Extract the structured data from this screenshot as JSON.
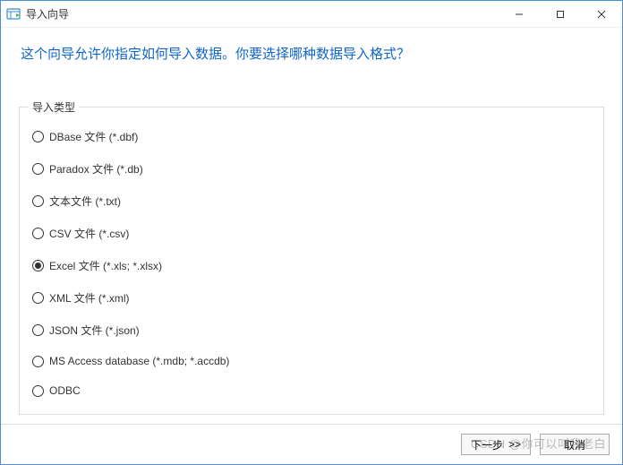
{
  "window": {
    "title": "导入向导"
  },
  "heading": "这个向导允许你指定如何导入数据。你要选择哪种数据导入格式？",
  "group": {
    "label": "导入类型",
    "options": [
      {
        "label": "DBase 文件 (*.dbf)",
        "selected": false
      },
      {
        "label": "Paradox 文件 (*.db)",
        "selected": false
      },
      {
        "label": "文本文件 (*.txt)",
        "selected": false
      },
      {
        "label": "CSV 文件 (*.csv)",
        "selected": false
      },
      {
        "label": "Excel 文件 (*.xls; *.xlsx)",
        "selected": true
      },
      {
        "label": "XML 文件 (*.xml)",
        "selected": false
      },
      {
        "label": "JSON 文件 (*.json)",
        "selected": false
      },
      {
        "label": "MS Access database (*.mdb; *.accdb)",
        "selected": false
      },
      {
        "label": "ODBC",
        "selected": false
      }
    ]
  },
  "buttons": {
    "next": "下一步",
    "next_suffix": ">>",
    "cancel": "取消"
  },
  "watermark": "CSDN @你可以叫我老白"
}
